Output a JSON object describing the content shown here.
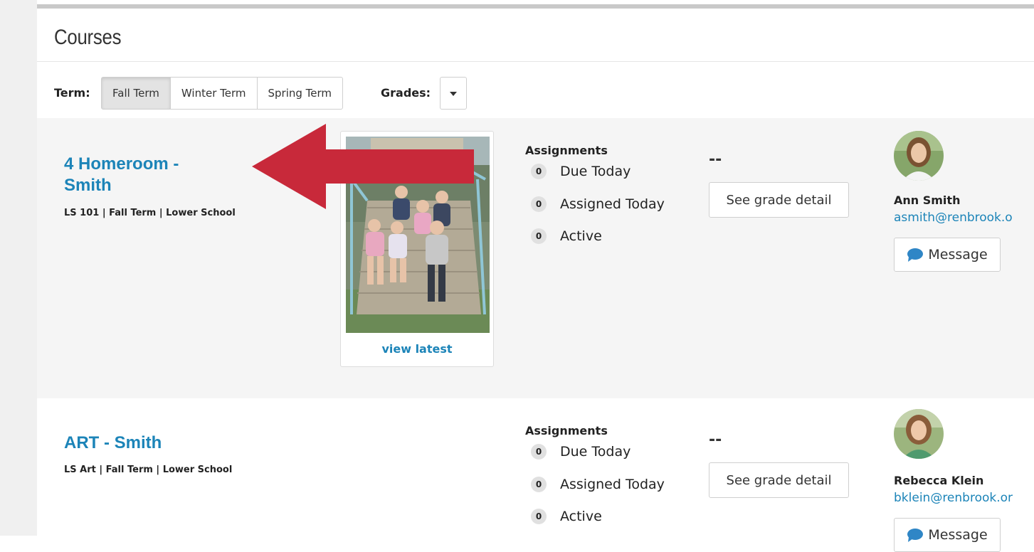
{
  "page": {
    "title": "Courses"
  },
  "filters": {
    "term_label": "Term:",
    "terms": [
      "Fall Term",
      "Winter Term",
      "Spring Term"
    ],
    "active_term": "Fall Term",
    "grades_label": "Grades:"
  },
  "courses": [
    {
      "title_line1": "4 Homeroom -",
      "title_line2": "Smith",
      "meta": "LS 101 | Fall Term | Lower School",
      "photo_link": "view latest",
      "assignments": {
        "heading": "Assignments",
        "items": [
          {
            "count": "0",
            "label": "Due Today"
          },
          {
            "count": "0",
            "label": "Assigned Today"
          },
          {
            "count": "0",
            "label": "Active"
          }
        ]
      },
      "grade": "--",
      "grade_button": "See grade detail",
      "teacher": {
        "name": "Ann Smith",
        "email": "asmith@renbrook.o",
        "message_label": "Message"
      }
    },
    {
      "title_line1": "ART - Smith",
      "meta": "LS Art | Fall Term | Lower School",
      "assignments": {
        "heading": "Assignments",
        "items": [
          {
            "count": "0",
            "label": "Due Today"
          },
          {
            "count": "0",
            "label": "Assigned Today"
          },
          {
            "count": "0",
            "label": "Active"
          }
        ]
      },
      "grade": "--",
      "grade_button": "See grade detail",
      "teacher": {
        "name": "Rebecca Klein",
        "email": "bklein@renbrook.or",
        "message_label": "Message"
      }
    }
  ],
  "annotation": {
    "arrow_color": "#c8293a",
    "icon": "arrow-left-icon"
  },
  "colors": {
    "link": "#1c84b8",
    "row_alt": "#f5f5f5",
    "message_icon": "#2f86c6"
  },
  "icons": {
    "message": "chat-bubble-icon",
    "dropdown": "caret-down-icon"
  }
}
